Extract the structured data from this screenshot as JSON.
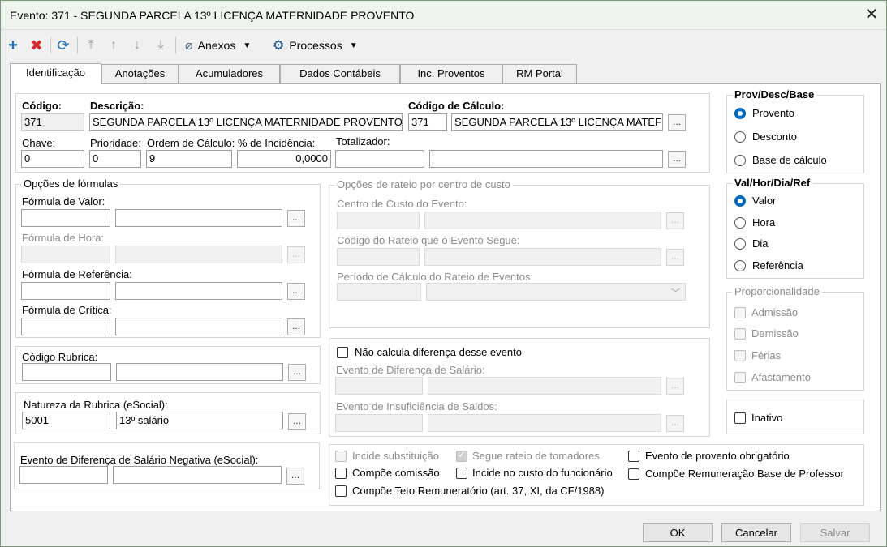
{
  "window": {
    "title": "Evento: 371 - SEGUNDA PARCELA 13º LICENÇA MATERNIDADE PROVENTO",
    "close": "✕"
  },
  "toolbar": {
    "anexos": "Anexos",
    "processos": "Processos"
  },
  "tabs": [
    "Identificação",
    "Anotações",
    "Acumuladores",
    "Dados Contábeis",
    "Inc. Proventos",
    "RM Portal"
  ],
  "ident": {
    "codigo_label": "Código:",
    "codigo": "371",
    "descricao_label": "Descrição:",
    "descricao": "SEGUNDA PARCELA 13º LICENÇA MATERNIDADE PROVENTO",
    "calc_label": "Código de Cálculo:",
    "calc_codigo": "371",
    "calc_desc": "SEGUNDA PARCELA 13º LICENÇA MATEF",
    "chave_label": "Chave:",
    "chave": "0",
    "prioridade_label": "Prioridade:",
    "prioridade": "0",
    "ordem_label": "Ordem de Cálculo:",
    "ordem": "9",
    "incid_label": "% de Incidência:",
    "incid": "0,0000",
    "totalizador_label": "Totalizador:"
  },
  "formulas": {
    "title": "Opções de fórmulas",
    "valor": "Fórmula de Valor:",
    "hora": "Fórmula de Hora:",
    "referencia": "Fórmula de Referência:",
    "critica": "Fórmula de Crítica:"
  },
  "rateio": {
    "title": "Opções de rateio por centro de custo",
    "centro": "Centro de Custo do Evento:",
    "codigo": "Código do Rateio que o Evento Segue:",
    "periodo": "Período de Cálculo do Rateio de Eventos:"
  },
  "rubrica": {
    "label": "Código Rubrica:"
  },
  "natureza": {
    "label": "Natureza da Rubrica (eSocial):",
    "codigo": "5001",
    "desc": "13º salário"
  },
  "negativa": {
    "label": "Evento de Diferença de Salário Negativa (eSocial):"
  },
  "diferenca": {
    "nao_calcula": "Não calcula diferença desse evento",
    "dif_salario": "Evento de Diferença de Salário:",
    "insuficiencia": "Evento de Insuficiência de Saldos:"
  },
  "checks": {
    "incide_subst": "Incide substituição",
    "segue_rateio": "Segue rateio de tomadores",
    "provento_obrig": "Evento de provento obrigatório",
    "compoe_comissao": "Compõe comissão",
    "incide_custo": "Incide no custo do funcionário",
    "compoe_base_prof": "Compõe Remuneração Base de Professor",
    "compoe_teto": "Compõe Teto Remuneratório (art. 37, XI, da CF/1988)"
  },
  "provdesc": {
    "title": "Prov/Desc/Base",
    "options": [
      "Provento",
      "Desconto",
      "Base de cálculo"
    ],
    "selected": "Provento"
  },
  "valhor": {
    "title": "Val/Hor/Dia/Ref",
    "options": [
      "Valor",
      "Hora",
      "Dia",
      "Referência"
    ],
    "selected": "Valor"
  },
  "proporcionalidade": {
    "title": "Proporcionalidade",
    "options": [
      "Admissão",
      "Demissão",
      "Férias",
      "Afastamento"
    ]
  },
  "inativo": "Inativo",
  "buttons": {
    "ok": "OK",
    "cancelar": "Cancelar",
    "salvar": "Salvar",
    "ellipsis": "..."
  }
}
